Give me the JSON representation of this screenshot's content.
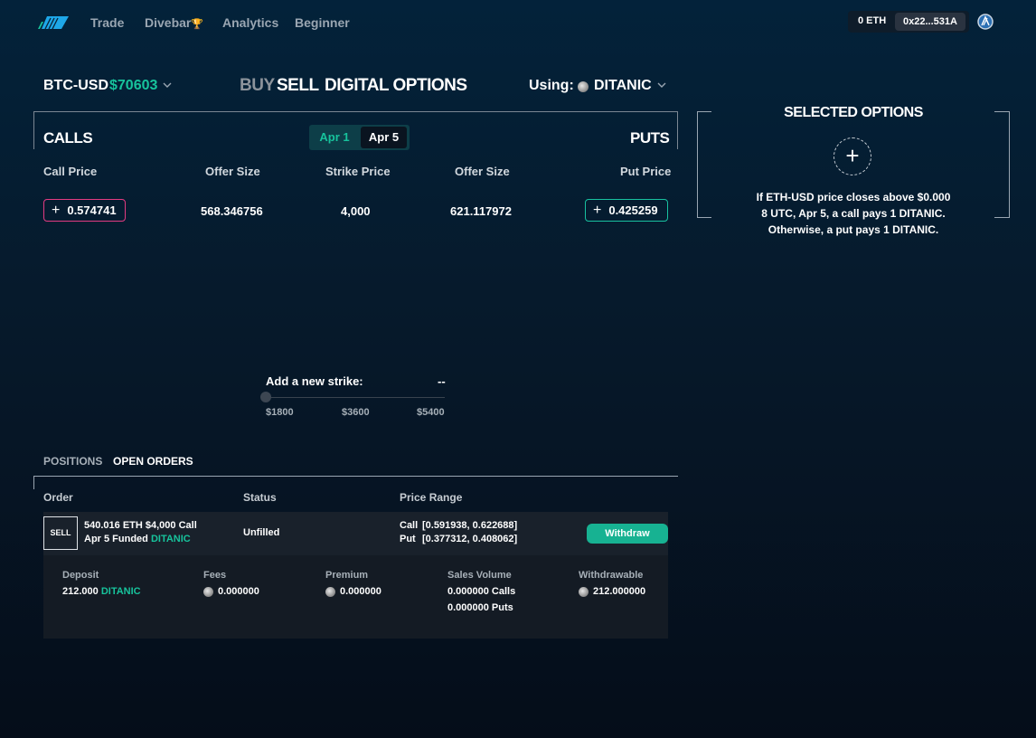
{
  "nav": {
    "items": [
      "Trade",
      "Divebar",
      "Analytics",
      "Beginner"
    ],
    "divebar_trophy": "🏆",
    "wallet": {
      "balance": "0 ETH",
      "address": "0x22...531A"
    }
  },
  "header": {
    "pair": "BTC-USD",
    "price": "$70603",
    "buy_label": "BUY",
    "sell_label": "SELL",
    "title": "DIGITAL OPTIONS",
    "using_label": "Using:",
    "using_token": "DITANIC"
  },
  "chain": {
    "calls_label": "CALLS",
    "puts_label": "PUTS",
    "dates": [
      "Apr 1",
      "Apr 5"
    ],
    "selected_date": "Apr 5",
    "columns": [
      "Call Price",
      "Offer Size",
      "Strike Price",
      "Offer Size",
      "Put Price"
    ],
    "rows": [
      {
        "call_price": "0.574741",
        "call_offer_size": "568.346756",
        "strike": "4,000",
        "put_offer_size": "621.117972",
        "put_price": "0.425259"
      }
    ],
    "plus_glyph": "+"
  },
  "slider": {
    "label": "Add a new strike:",
    "value": "--",
    "ticks": [
      "$1800",
      "$3600",
      "$5400"
    ],
    "position": 0
  },
  "selected_options": {
    "title": "SELECTED OPTIONS",
    "plus_glyph": "+",
    "description_1": "If ETH-USD price closes above $0.000",
    "description_2": "8 UTC, Apr 5, a call pays 1 DITANIC.",
    "description_3": "Otherwise, a put pays 1 DITANIC."
  },
  "orders": {
    "tabs": [
      "POSITIONS",
      "OPEN ORDERS"
    ],
    "active_tab": "OPEN ORDERS",
    "columns": [
      "Order",
      "Status",
      "Price Range"
    ],
    "order": {
      "side": "SELL",
      "line1": "540.016 ETH $4,000 Call",
      "line2_prefix": "Apr 5 Funded ",
      "line2_token": "DITANIC",
      "status": "Unfilled",
      "call_range_label": "Call",
      "call_range": "[0.591938, 0.622688]",
      "put_range_label": "Put",
      "put_range": "[0.377312, 0.408062]",
      "action": "Withdraw"
    },
    "details": {
      "deposit_label": "Deposit",
      "deposit_value": "212.000",
      "deposit_token": "DITANIC",
      "fees_label": "Fees",
      "fees_value": "0.000000",
      "premium_label": "Premium",
      "premium_value": "0.000000",
      "sales_label": "Sales Volume",
      "sales_calls": "0.000000 Calls",
      "sales_puts": "0.000000 Puts",
      "withdrawable_label": "Withdrawable",
      "withdrawable_value": "212.000000"
    }
  },
  "colors": {
    "accent": "#17c39c",
    "call_border": "#e33b82",
    "put_border": "#18c1a0",
    "withdraw_bg": "#17b292"
  }
}
